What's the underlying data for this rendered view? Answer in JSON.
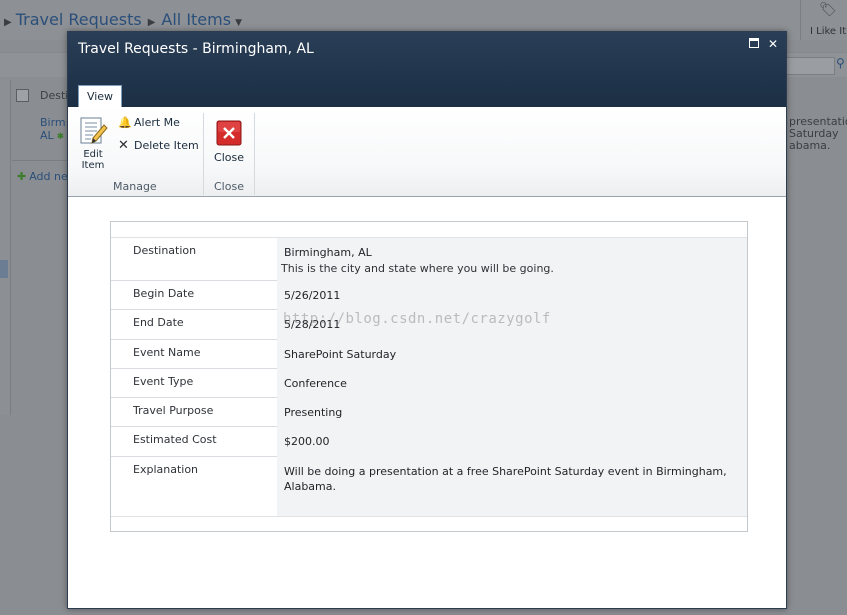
{
  "background": {
    "breadcrumb": {
      "site": "Travel Requests",
      "view": "All Items"
    },
    "like_it": "I Like It",
    "list": {
      "column_header": "Desti",
      "row_text_1": "Birm",
      "row_text_2": "AL",
      "add_new": "Add ne",
      "right_peek_1": "presentatio",
      "right_peek_2": "Saturday",
      "right_peek_3": "abama."
    }
  },
  "dialog": {
    "title": "Travel Requests - Birmingham, AL",
    "tab": "View",
    "ribbon": {
      "edit_item": "Edit Item",
      "alert_me": "Alert Me",
      "delete_item": "Delete Item",
      "manage_group": "Manage",
      "close_button": "Close",
      "close_group": "Close"
    },
    "fields": [
      {
        "label": "Destination",
        "value": "Birmingham, AL",
        "description": "This is the city and state where you will be going."
      },
      {
        "label": "Begin Date",
        "value": "5/26/2011"
      },
      {
        "label": "End Date",
        "value": "5/28/2011"
      },
      {
        "label": "Event Name",
        "value": "SharePoint Saturday"
      },
      {
        "label": "Event Type",
        "value": "Conference"
      },
      {
        "label": "Travel Purpose",
        "value": "Presenting"
      },
      {
        "label": "Estimated Cost",
        "value": "$200.00"
      },
      {
        "label": "Explanation",
        "value": "Will be doing a presentation at a free SharePoint Saturday event in Birmingham, Alabama."
      }
    ]
  },
  "watermark": "http://blog.csdn.net/crazygolf",
  "colors": {
    "titlebar": "#20344b",
    "ribbon_bg": "#f7f8f9",
    "field_bg": "#f2f3f4",
    "delete_button_red": "#d42b2b"
  }
}
